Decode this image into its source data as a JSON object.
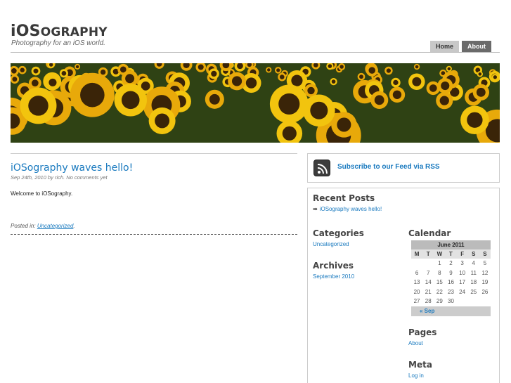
{
  "site": {
    "title_big": "iOS",
    "title_small": "OGRAPHY",
    "tagline": "Photography for an iOS world."
  },
  "nav": {
    "home": "Home",
    "about": "About"
  },
  "post": {
    "title": "iOSography waves hello!",
    "meta": "Sep 24th, 2010 by rich. No comments yet",
    "body": "Welcome to iOSography.",
    "posted_in_label": "Posted in:",
    "category": "Uncategorized",
    "period": "."
  },
  "rss": {
    "label": "Subscribe to our Feed via RSS",
    "icon": "rss-icon"
  },
  "sidebar": {
    "recent_title": "Recent Posts",
    "recent_item": "iOSography waves hello!",
    "categories_title": "Categories",
    "categories_item": "Uncategorized",
    "archives_title": "Archives",
    "archives_item": "September 2010",
    "calendar_title": "Calendar",
    "pages_title": "Pages",
    "pages_item": "About",
    "meta_title": "Meta",
    "meta_item": "Log in"
  },
  "calendar": {
    "caption": "June 2011",
    "days": [
      "M",
      "T",
      "W",
      "T",
      "F",
      "S",
      "S"
    ],
    "weeks": [
      [
        "",
        "",
        "1",
        "2",
        "3",
        "4",
        "5"
      ],
      [
        "6",
        "7",
        "8",
        "9",
        "10",
        "11",
        "12"
      ],
      [
        "13",
        "14",
        "15",
        "16",
        "17",
        "18",
        "19"
      ],
      [
        "20",
        "21",
        "22",
        "23",
        "24",
        "25",
        "26"
      ],
      [
        "27",
        "28",
        "29",
        "30",
        "",
        "",
        ""
      ]
    ],
    "prev": "« Sep"
  },
  "colors": {
    "link": "#1a7abf",
    "nav_active": "#6a6a6a",
    "nav_inactive": "#c8c8c8"
  }
}
